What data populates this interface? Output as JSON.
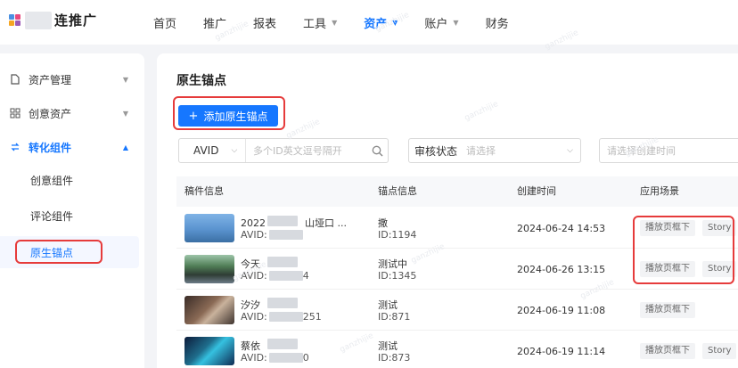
{
  "logo": {
    "text": "连推广"
  },
  "nav": {
    "items": [
      {
        "label": "首页",
        "caret": false,
        "active": false
      },
      {
        "label": "推广",
        "caret": false,
        "active": false
      },
      {
        "label": "报表",
        "caret": false,
        "active": false
      },
      {
        "label": "工具",
        "caret": true,
        "active": false
      },
      {
        "label": "资产",
        "caret": true,
        "active": true
      },
      {
        "label": "账户",
        "caret": true,
        "active": false
      },
      {
        "label": "财务",
        "caret": false,
        "active": false
      }
    ]
  },
  "sidebar": {
    "menus": [
      {
        "label": "资产管理",
        "icon": "file-icon",
        "open": false
      },
      {
        "label": "创意资产",
        "icon": "grid-icon",
        "open": false
      },
      {
        "label": "转化组件",
        "icon": "convert-icon",
        "open": true
      }
    ],
    "sub_items": [
      {
        "label": "创意组件",
        "selected": false
      },
      {
        "label": "评论组件",
        "selected": false
      },
      {
        "label": "原生锚点",
        "selected": true
      }
    ]
  },
  "page": {
    "title": "原生锚点",
    "add_button": "添加原生锚点"
  },
  "filters": {
    "id_type": "AVID",
    "id_placeholder": "多个ID英文逗号隔开",
    "audit_label": "审核状态",
    "audit_placeholder": "请选择",
    "time_placeholder": "请选择创建时间"
  },
  "table": {
    "headers": [
      "稿件信息",
      "锚点信息",
      "创建时间",
      "应用场景"
    ],
    "rows": [
      {
        "material_name": "2022",
        "material_name_tail": "山垭口 ...",
        "material_id": "AVID:",
        "material_id_tail": "",
        "anchor_name": "撒",
        "anchor_id": "ID:1194",
        "created": "2024-06-24 14:53",
        "tags": [
          "播放页框下",
          "Story"
        ]
      },
      {
        "material_name": "今天",
        "material_name_tail": "",
        "material_id": "AVID:",
        "material_id_tail": "4",
        "anchor_name": "测试中",
        "anchor_id": "ID:1345",
        "created": "2024-06-26 13:15",
        "tags": [
          "播放页框下",
          "Story"
        ]
      },
      {
        "material_name": "汐汐",
        "material_name_tail": "",
        "material_id": "AVID:",
        "material_id_tail": "251",
        "anchor_name": "测试",
        "anchor_id": "ID:871",
        "created": "2024-06-19 11:08",
        "tags": [
          "播放页框下"
        ]
      },
      {
        "material_name": "蔡依",
        "material_name_tail": "",
        "material_id": "AVID:",
        "material_id_tail": "0",
        "anchor_name": "测试",
        "anchor_id": "ID:873",
        "created": "2024-06-19 11:14",
        "tags": [
          "播放页框下",
          "Story"
        ]
      }
    ]
  },
  "colors": {
    "accent": "#1677ff",
    "highlight": "#e63b3b",
    "brand": [
      "#4a90e2",
      "#e84a7f",
      "#f5a623"
    ]
  },
  "watermark": "ganzhijie"
}
